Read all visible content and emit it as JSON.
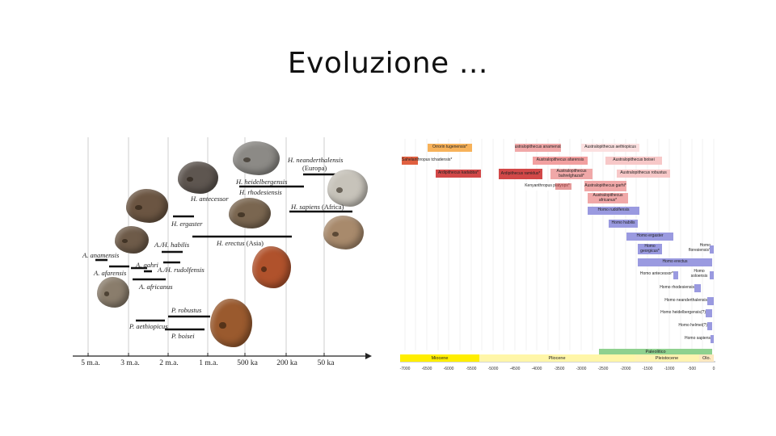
{
  "slide": {
    "title": "Evoluzione …"
  },
  "left_figure": {
    "axis_ticks": [
      "5 m.a.",
      "3 m.a.",
      "2 m.a.",
      "1 m.a.",
      "500 ka",
      "200 ka",
      "50 ka"
    ],
    "labels": {
      "anamensis": "A. anamensis",
      "afarensis": "A. afarensis",
      "gahri": "A. gahri",
      "africanus": "A. africanus",
      "habilis": "A./H. habilis",
      "rudolfensis": "A./H. rudolfensis",
      "ergaster": "H. ergaster",
      "erectus": "H. erectus",
      "erectus_region": "(Asia)",
      "antecessor": "H. antecessor",
      "heidelbergensis": "H. heidelbergensis",
      "rhodesiensis": "H. rhodesiensis",
      "neanderthalensis": "H. neanderthalensis",
      "neanderthalensis_region": "(Europa)",
      "sapiens": "H. sapiens",
      "sapiens_region": "(Africa)",
      "robustus": "P. robustus",
      "aethiopicus": "P. aethiopicus",
      "boisei": "P. boisei"
    }
  },
  "right_figure": {
    "boxes": {
      "orrorin": "Orrorin tugenensis*",
      "anamensis": "Australopithecus anamensis*",
      "aethiopicus": "Australopithecus aethiopicus",
      "sahelanthropus": "Sahelanthropus tchadensis*",
      "afarensis": "Australopithecus afarensis",
      "boisei": "Australopithecus boisei",
      "kadabba": "Ardipithecus kadabba*",
      "ramidus": "Ardipithecus ramidus*",
      "bahrelghazali": "Australopithecus bahrelghazali*",
      "robustus": "Australopithecus robustus",
      "kenyanthropus": "Kenyanthropus platyops*",
      "garhi": "Australopithecus garhi*",
      "africanus": "Australopithecus africanus*",
      "rudolfensis": "Homo rudolfensis",
      "habilis": "Homo habilis",
      "ergaster": "Homo ergaster",
      "georgicus": "Homo georgicus*",
      "floresiensis": "Homo floresiensis*",
      "erectus": "Homo erectus",
      "antecessor": "Homo antecessor*",
      "soloensis": "Homo soloensis",
      "rhodesiensis": "Homo rhodesiensis",
      "neanderthalensis": "Homo neanderthalensis",
      "heidelbergensis": "Homo heidelbergensis(?)",
      "helmei": "Homo helmei(?)",
      "sapiens": "Homo sapiens"
    },
    "epochs": {
      "miocene": "Miocene",
      "pliocene": "Pliocene",
      "paleolithic": "Paleolitico",
      "pleistocene": "Pleistocene",
      "holocene": "Olo."
    },
    "ticks": [
      "-7000",
      "-6500",
      "-6000",
      "-5500",
      "-5000",
      "-4500",
      "-4000",
      "-3500",
      "-3000",
      "-2500",
      "-2000",
      "-1500",
      "-1000",
      "-500",
      "0"
    ]
  }
}
